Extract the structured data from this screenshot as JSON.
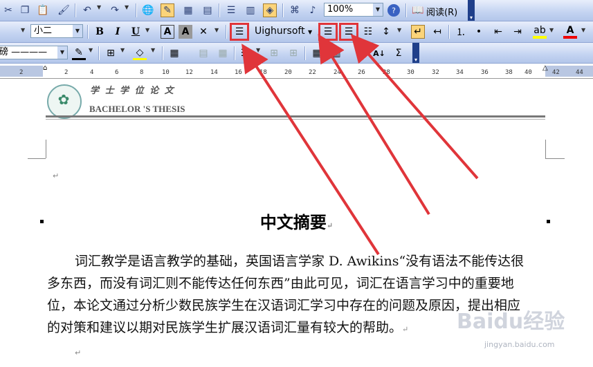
{
  "toolbar1": {
    "zoom": "100%",
    "read_label": "阅读(R)",
    "icons": [
      "cut-icon",
      "copy-icon",
      "paste-icon",
      "format-painter-icon",
      "undo-icon",
      "redo-icon",
      "hyperlink-icon",
      "tables-borders-icon",
      "insert-table-icon",
      "insert-excel-icon",
      "columns-icon",
      "drawing-icon",
      "document-map-icon",
      "show-hide-icon",
      "help-icon",
      "read-icon"
    ]
  },
  "toolbar2": {
    "font_size": "小二",
    "font_name": "Uighursoft",
    "bold": "B",
    "italic": "I",
    "underline": "U"
  },
  "toolbar3": {
    "line_weight": "磅",
    "sum_symbol": "Σ"
  },
  "ruler": {
    "ticks": [
      "2",
      "2",
      "4",
      "6",
      "8",
      "10",
      "12",
      "14",
      "16",
      "18",
      "20",
      "22",
      "24",
      "26",
      "28",
      "30",
      "32",
      "34",
      "36",
      "38",
      "40",
      "42",
      "44"
    ]
  },
  "document": {
    "header_cn": "学 士 学 位 论 文",
    "header_en": "BACHELOR 'S THESIS",
    "title": "中文摘要",
    "para_lines": [
      "词汇教学是语言教学的基础，英国语言学家 D. Awikins“没有语法不能传达很",
      "多东西，而没有词汇则不能传达任何东西”由此可见，词汇在语言学习中的重要地",
      "位，本论文通过分析少数民族学生在汉语词汇学习中存在的问题及原因，提出相应",
      "的对策和建议以期对民族学生扩展汉语词汇量有较大的帮助。"
    ],
    "para_mark": "↵"
  },
  "watermark": {
    "brand": "Baidu经验",
    "url": "jingyan.baidu.com"
  },
  "colors": {
    "annotation": "#e0353a",
    "toolbar": "#c3d3f1",
    "highlight": "#fbd47a"
  }
}
